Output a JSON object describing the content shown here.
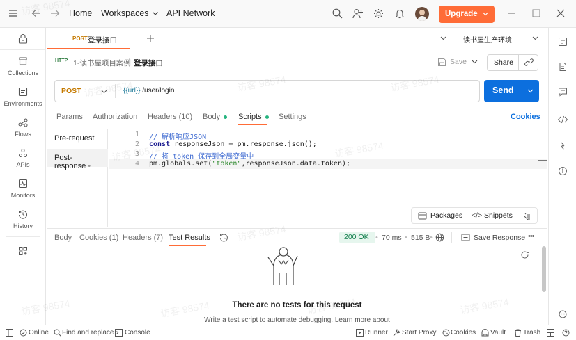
{
  "titlebar": {
    "home": "Home",
    "workspaces": "Workspaces",
    "api_network": "API Network",
    "upgrade": "Upgrade"
  },
  "sidebar": {
    "items": [
      {
        "label": "Collections",
        "icon": "collections-icon"
      },
      {
        "label": "Environments",
        "icon": "environments-icon"
      },
      {
        "label": "Flows",
        "icon": "flows-icon"
      },
      {
        "label": "APIs",
        "icon": "apis-icon"
      },
      {
        "label": "Monitors",
        "icon": "monitors-icon"
      },
      {
        "label": "History",
        "icon": "history-icon"
      }
    ]
  },
  "tab": {
    "method": "POST",
    "name": "登录接口",
    "environment": "读书屋生产环境"
  },
  "breadcrumb": {
    "collection": "1-读书屋项目案例",
    "separator": "/",
    "request": "登录接口",
    "save": "Save",
    "share": "Share"
  },
  "request": {
    "method": "POST",
    "url_var": "{{url}}",
    "url_path": " /user/login",
    "send": "Send",
    "cookies": "Cookies"
  },
  "req_tabs": {
    "params": "Params",
    "authorization": "Authorization",
    "headers": "Headers (10)",
    "body": "Body",
    "scripts": "Scripts",
    "settings": "Settings"
  },
  "scripts_side": {
    "pre": "Pre-request",
    "post": "Post-response"
  },
  "code": {
    "lines": [
      {
        "n": "1",
        "text": "// 解析响应JSON"
      },
      {
        "n": "2",
        "kw": "const",
        "text": " responseJson = pm.response.json();"
      },
      {
        "n": "3",
        "text": "// 将 token 保存到全局变量中"
      },
      {
        "n": "4",
        "pre": "pm.globals.set(",
        "str": "\"token\"",
        "post": ",responseJson.data.token);"
      }
    ]
  },
  "editor_tools": {
    "packages": "Packages",
    "snippets": "Snippets"
  },
  "response": {
    "body": "Body",
    "cookies": "Cookies (1)",
    "headers": "Headers (7)",
    "test_results": "Test Results",
    "status": "200 OK",
    "time": "70 ms",
    "size": "515 B",
    "save_response": "Save Response",
    "empty_title": "There are no tests for this request",
    "empty_sub": "Write a test script to automate debugging. Learn more about"
  },
  "statusbar": {
    "online": "Online",
    "find_replace": "Find and replace",
    "console": "Console",
    "runner": "Runner",
    "start_proxy": "Start Proxy",
    "cookies": "Cookies",
    "vault": "Vault",
    "trash": "Trash"
  },
  "watermark": "访客 98574",
  "colors": {
    "accent": "#ff6c37",
    "send": "#0c6fde",
    "ok": "#0f7d4a",
    "method": "#c57a00"
  }
}
